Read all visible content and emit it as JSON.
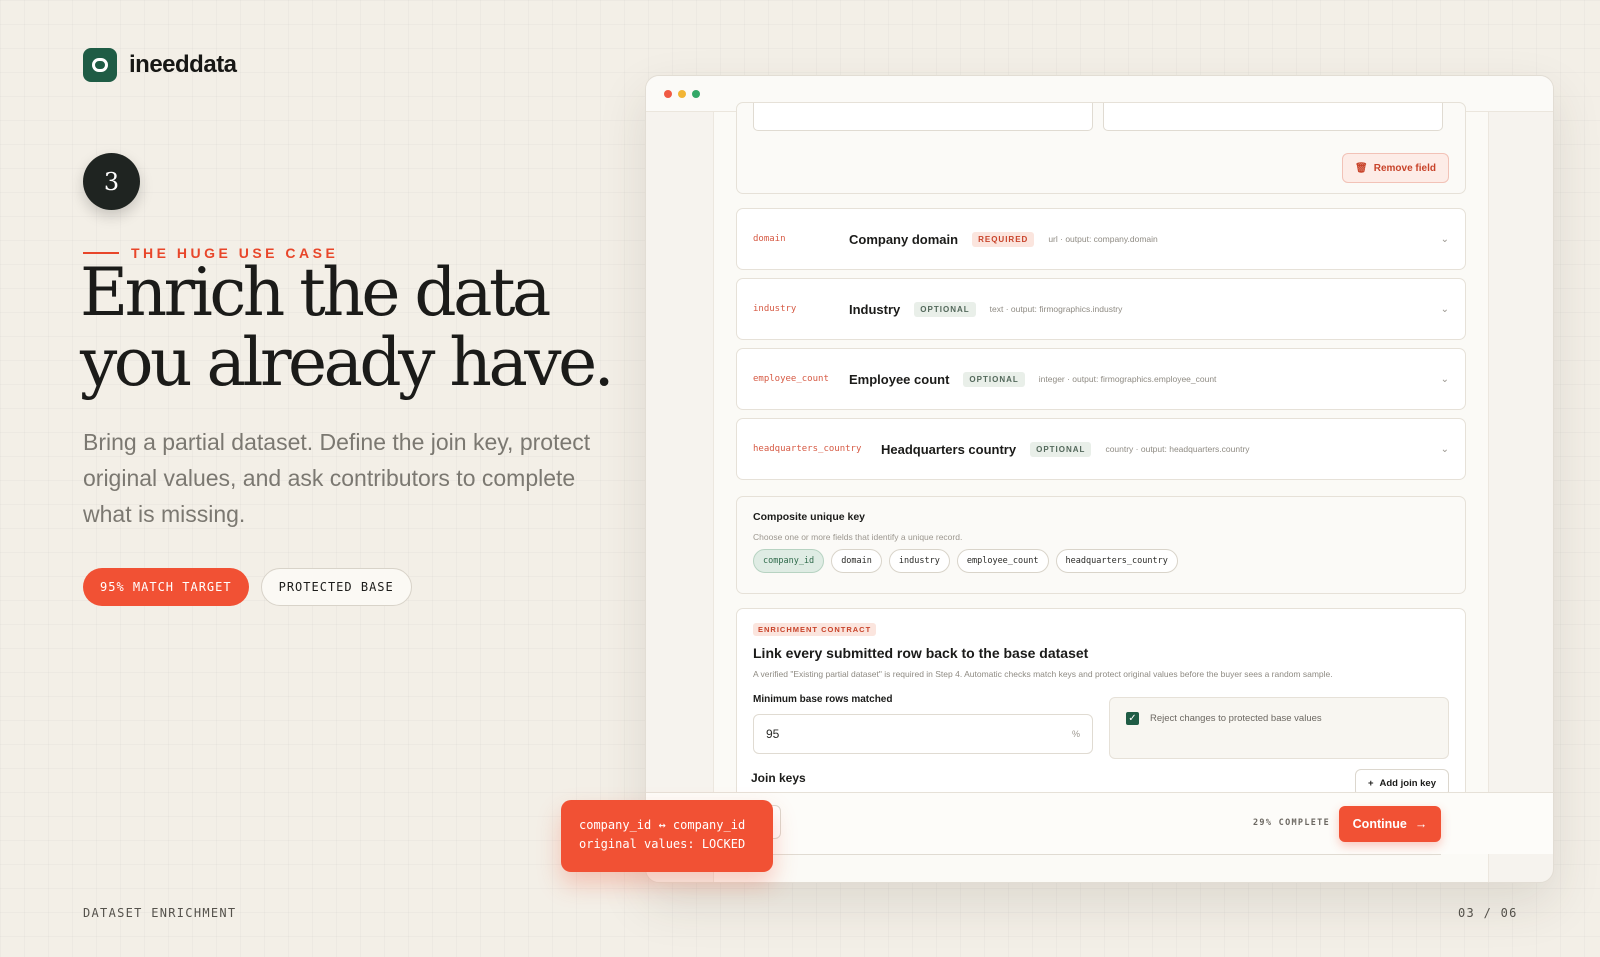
{
  "brand": {
    "name": "ineeddata"
  },
  "step": {
    "number": "3"
  },
  "eyebrow": "THE HUGE USE CASE",
  "headline": {
    "line1": "Enrich the data",
    "line2": "you already have."
  },
  "lead": "Bring a partial dataset. Define the join key, protect original values, and ask contributors to complete what is missing.",
  "pills": {
    "match": "95% MATCH TARGET",
    "protected": "PROTECTED BASE"
  },
  "footer": {
    "section": "DATASET ENRICHMENT",
    "page": "03 / 06"
  },
  "window": {
    "remove_field": "Remove field",
    "fields": [
      {
        "key": "domain",
        "label": "Company domain",
        "badge": "REQUIRED",
        "meta": "url · output: company.domain"
      },
      {
        "key": "industry",
        "label": "Industry",
        "badge": "OPTIONAL",
        "meta": "text · output: firmographics.industry"
      },
      {
        "key": "employee_count",
        "label": "Employee count",
        "badge": "OPTIONAL",
        "meta": "integer · output: firmographics.employee_count"
      },
      {
        "key": "headquarters_country",
        "label": "Headquarters country",
        "badge": "OPTIONAL",
        "meta": "country · output: headquarters.country"
      }
    ],
    "composite": {
      "title": "Composite unique key",
      "subtitle": "Choose one or more fields that identify a unique record.",
      "chips": [
        "company_id",
        "domain",
        "industry",
        "employee_count",
        "headquarters_country"
      ]
    },
    "contract": {
      "tag": "ENRICHMENT CONTRACT",
      "title": "Link every submitted row back to the base dataset",
      "description": "A verified \"Existing partial dataset\" is required in Step 4. Automatic checks match keys and protect original values before the buyer sees a random sample.",
      "min_label": "Minimum base rows matched",
      "min_value": "95",
      "min_unit": "%",
      "reject_label": "Reject changes to protected base values",
      "join_keys_label": "Join keys",
      "add_join_label": "Add join key"
    },
    "bottom": {
      "back_label": "k",
      "progress": "29% COMPLETE",
      "continue_label": "Continue"
    }
  },
  "callout": {
    "line1": "company_id ↔ company_id",
    "line2": "original values: LOCKED"
  },
  "colors": {
    "accent": "#f15134",
    "brand": "#1f5c45",
    "background": "#f3efe7"
  }
}
